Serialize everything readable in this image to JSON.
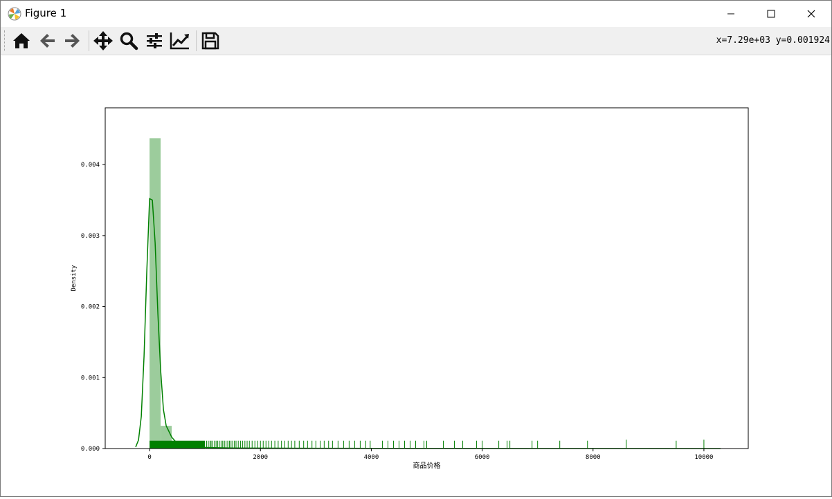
{
  "window": {
    "title": "Figure 1",
    "coords_readout": "x=7.29e+03 y=0.001924"
  },
  "toolbar": {
    "items": [
      {
        "name": "home",
        "icon": "home-icon"
      },
      {
        "name": "back",
        "icon": "arrow-left-icon"
      },
      {
        "name": "forward",
        "icon": "arrow-right-icon"
      },
      {
        "name": "pan",
        "icon": "move-icon"
      },
      {
        "name": "zoom",
        "icon": "magnifier-icon"
      },
      {
        "name": "subplots",
        "icon": "sliders-icon"
      },
      {
        "name": "axes",
        "icon": "line-chart-icon"
      },
      {
        "name": "save",
        "icon": "floppy-icon"
      }
    ]
  },
  "colors": {
    "accent": "#008000",
    "bar_fill": "#9ccc9c"
  },
  "chart_data": {
    "type": "bar",
    "xlabel": "商品价格",
    "ylabel": "Density",
    "xlim": [
      -800,
      10800
    ],
    "ylim": [
      0,
      0.0048
    ],
    "xticks": [
      0,
      2000,
      4000,
      6000,
      8000,
      10000
    ],
    "yticks": [
      0.0,
      0.001,
      0.002,
      0.003,
      0.004
    ],
    "xtick_labels": [
      "0",
      "2000",
      "4000",
      "6000",
      "8000",
      "10000"
    ],
    "ytick_labels": [
      "0.000",
      "0.001",
      "0.002",
      "0.003",
      "0.004"
    ],
    "histogram": {
      "bin_edges": [
        0,
        200,
        400,
        600,
        800,
        1000,
        1200,
        1400,
        1600,
        1800,
        2000,
        2500,
        3000,
        3500,
        4000,
        5000,
        6000,
        7000,
        8000,
        9000,
        10000
      ],
      "densities": [
        0.00437,
        0.00032,
        0.0001,
        5e-05,
        3e-05,
        2e-05,
        1.5e-05,
        1e-05,
        1e-05,
        8e-06,
        6e-06,
        5e-06,
        4e-06,
        3e-06,
        2e-06,
        1.5e-06,
        1e-06,
        1e-06,
        8e-07,
        5e-07
      ]
    },
    "kde": {
      "x": [
        -250,
        -200,
        -150,
        -100,
        -50,
        0,
        50,
        100,
        150,
        200,
        250,
        300,
        400,
        500,
        600,
        800,
        1000,
        1500,
        2000,
        3000,
        4000,
        5000,
        6000,
        7000,
        8000,
        9000,
        10000,
        10300
      ],
      "y": [
        2e-05,
        0.00012,
        0.00045,
        0.0013,
        0.0025,
        0.00352,
        0.0035,
        0.0029,
        0.0019,
        0.0011,
        0.00055,
        0.00032,
        0.00016,
        7e-05,
        4e-05,
        2e-05,
        1.5e-05,
        8e-06,
        6e-06,
        4e-06,
        3e-06,
        2e-06,
        1.5e-06,
        1e-06,
        8e-07,
        5e-07,
        3e-07,
        0.0
      ]
    },
    "rug": {
      "tall_height": 0.000125,
      "short_height": 0.00011,
      "dense_range": [
        0,
        1000
      ],
      "points": [
        1030,
        1060,
        1090,
        1110,
        1140,
        1170,
        1200,
        1230,
        1260,
        1290,
        1320,
        1350,
        1380,
        1410,
        1440,
        1470,
        1500,
        1530,
        1560,
        1600,
        1640,
        1680,
        1720,
        1760,
        1800,
        1850,
        1900,
        1950,
        2000,
        2050,
        2100,
        2150,
        2200,
        2260,
        2320,
        2380,
        2440,
        2500,
        2560,
        2620,
        2700,
        2780,
        2850,
        2930,
        3000,
        3080,
        3150,
        3230,
        3300,
        3400,
        3500,
        3600,
        3700,
        3800,
        3900,
        3980,
        4200,
        4300,
        4400,
        4500,
        4600,
        4700,
        4800,
        4950,
        5000,
        5300,
        5500,
        5650,
        5900,
        6000,
        6300,
        6450,
        6500,
        6900,
        7000,
        7400,
        7900,
        8600,
        9500,
        10000
      ],
      "tall_points": [
        8600,
        10000
      ]
    }
  }
}
